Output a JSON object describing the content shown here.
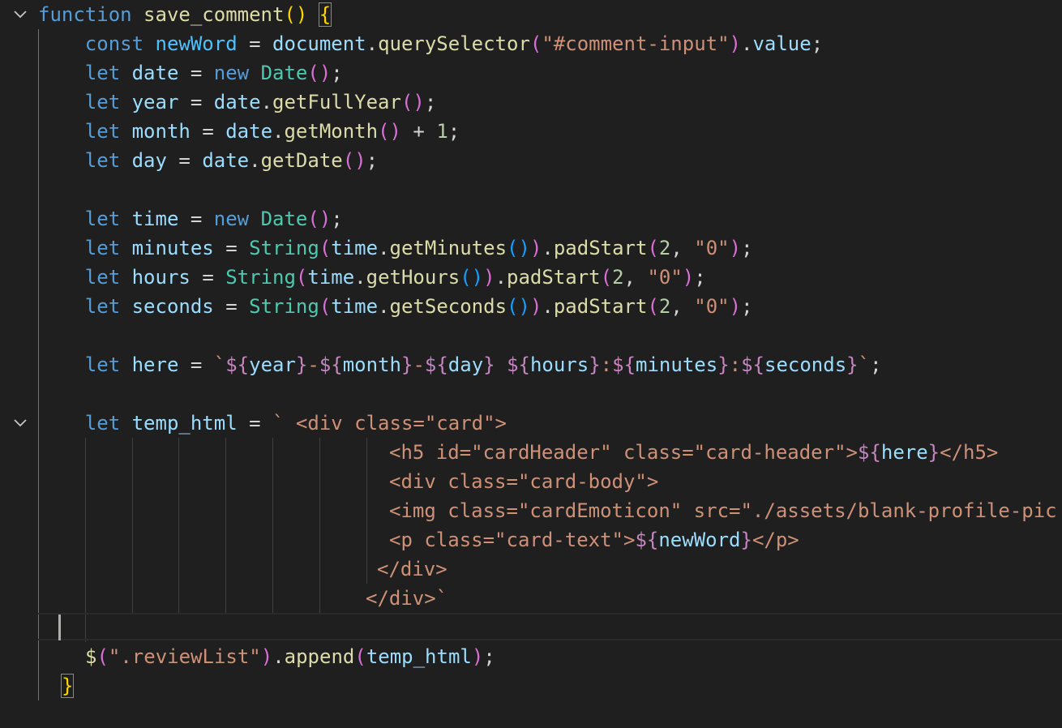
{
  "editor": {
    "fold_icon_1": "chevron-down",
    "fold_icon_2": "chevron-down",
    "lines": [
      "function save_comment() {",
      "    const newWord = document.querySelector(\"#comment-input\").value;",
      "    let date = new Date();",
      "    let year = date.getFullYear();",
      "    let month = date.getMonth() + 1;",
      "    let day = date.getDate();",
      "",
      "    let time = new Date();",
      "    let minutes = String(time.getMinutes()).padStart(2, \"0\");",
      "    let hours = String(time.getHours()).padStart(2, \"0\");",
      "    let seconds = String(time.getSeconds()).padStart(2, \"0\");",
      "",
      "    let here = `${year}-${month}-${day} ${hours}:${minutes}:${seconds}`;",
      "",
      "    let temp_html = ` <div class=\"card\">",
      "                         <h5 id=\"cardHeader\" class=\"card-header\">${here}</h5>",
      "                         <div class=\"card-body\">",
      "                         <img class=\"cardEmoticon\" src=\"./assets/blank-profile-pic",
      "                         <p class=\"card-text\">${newWord}</p>",
      "                        </div>",
      "                       </div>`",
      "",
      "    $(\".reviewList\").append(temp_html);",
      "  }"
    ]
  },
  "tokens": {
    "l1": [
      "function",
      "save_comment",
      "(",
      ")",
      "{"
    ],
    "l2": [
      "const",
      "newWord",
      "=",
      "document",
      ".",
      "querySelector",
      "(",
      "\"#comment-input\"",
      ")",
      ".",
      "value",
      ";"
    ],
    "l3": [
      "let",
      "date",
      "=",
      "new",
      "Date",
      "(",
      ")",
      ";"
    ],
    "l4": [
      "let",
      "year",
      "=",
      "date",
      ".",
      "getFullYear",
      "(",
      ")",
      ";"
    ],
    "l5": [
      "let",
      "month",
      "=",
      "date",
      ".",
      "getMonth",
      "(",
      ")",
      "+",
      "1",
      ";"
    ],
    "l6": [
      "let",
      "day",
      "=",
      "date",
      ".",
      "getDate",
      "(",
      ")",
      ";"
    ],
    "l8": [
      "let",
      "time",
      "=",
      "new",
      "Date",
      "(",
      ")",
      ";"
    ],
    "l9": [
      "let",
      "minutes",
      "=",
      "String",
      "(",
      "time",
      ".",
      "getMinutes",
      "(",
      ")",
      ")",
      ".",
      "padStart",
      "(",
      "2",
      ",",
      "\"0\"",
      ")",
      ";"
    ],
    "l10": [
      "let",
      "hours",
      "=",
      "String",
      "(",
      "time",
      ".",
      "getHours",
      "(",
      ")",
      ")",
      ".",
      "padStart",
      "(",
      "2",
      ",",
      "\"0\"",
      ")",
      ";"
    ],
    "l11": [
      "let",
      "seconds",
      "=",
      "String",
      "(",
      "time",
      ".",
      "getSeconds",
      "(",
      ")",
      ")",
      ".",
      "padStart",
      "(",
      "2",
      ",",
      "\"0\"",
      ")",
      ";"
    ],
    "l13": [
      "let",
      "here",
      "=",
      "`",
      "${",
      "year",
      "}",
      "-",
      "${",
      "month",
      "}",
      "-",
      "${",
      "day",
      "}",
      " ",
      "${",
      "hours",
      "}",
      ":",
      "${",
      "minutes",
      "}",
      ":",
      "${",
      "seconds",
      "}",
      "`",
      ";"
    ],
    "l15": [
      "let",
      "temp_html",
      "=",
      "` <div class=\"card\">"
    ],
    "l16": [
      "<h5 id=\"cardHeader\" class=\"card-header\">",
      "${",
      "here",
      "}",
      "</h5>"
    ],
    "l17": [
      "<div class=\"card-body\">"
    ],
    "l18": [
      "<img class=\"cardEmoticon\" src=\"./assets/blank-profile-pic"
    ],
    "l19": [
      "<p class=\"card-text\">",
      "${",
      "newWord",
      "}",
      "</p>"
    ],
    "l20": [
      "</div>"
    ],
    "l21": [
      "</div>`"
    ],
    "l23": [
      "$",
      "(",
      "\".reviewList\"",
      ")",
      ".",
      "append",
      "(",
      "temp_html",
      ")",
      ";"
    ],
    "l24": [
      "}"
    ]
  }
}
